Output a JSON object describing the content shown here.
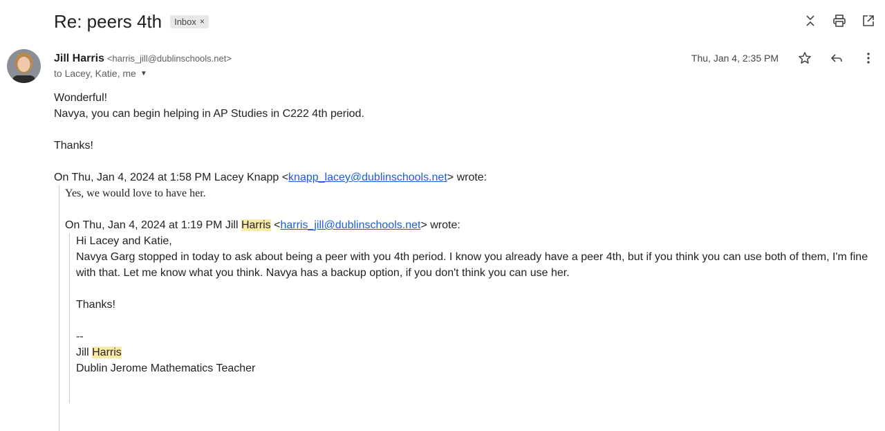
{
  "subject": "Re: peers 4th",
  "label_chip": {
    "text": "Inbox",
    "remove": "×"
  },
  "top_icons": [
    "expand-collapse-icon",
    "print-icon",
    "open-new-window-icon"
  ],
  "sender": {
    "name": "Jill Harris",
    "email": "<harris_jill@dublinschools.net>",
    "to": "to Lacey, Katie, me"
  },
  "date": "Thu, Jan 4, 2:35 PM",
  "message": {
    "line1": "Wonderful!",
    "line2": "Navya, you can begin helping in AP Studies in C222 4th period.",
    "line3": "Thanks!"
  },
  "quote1": {
    "header_pre": "On Thu, Jan 4, 2024 at 1:58 PM Lacey Knapp <",
    "header_link": "knapp_lacey@dublinschools.net",
    "header_post": "> wrote:",
    "text": "Yes, we would love to have her."
  },
  "quote2": {
    "header_pre": "On Thu, Jan 4, 2024 at 1:19 PM Jill ",
    "header_hl": "Harris",
    "header_mid": " <",
    "header_link": "harris_jill@dublinschools.net",
    "header_post": "> wrote:",
    "greeting": "Hi Lacey and Katie,",
    "para": "Navya Garg stopped in today to ask about being a peer with you 4th period. I know you already have a peer 4th, but if you think you can use both of them, I'm fine with that. Let me know what you think.  Navya has a backup option, if you don't think you can use her.",
    "thanks": "Thanks!",
    "sig_dash": "--",
    "sig_first": "Jill ",
    "sig_hl": "Harris",
    "sig_title": "Dublin Jerome Mathematics Teacher"
  },
  "colors": {
    "highlight": "#fce9a6",
    "link": "#1a5fd0"
  }
}
